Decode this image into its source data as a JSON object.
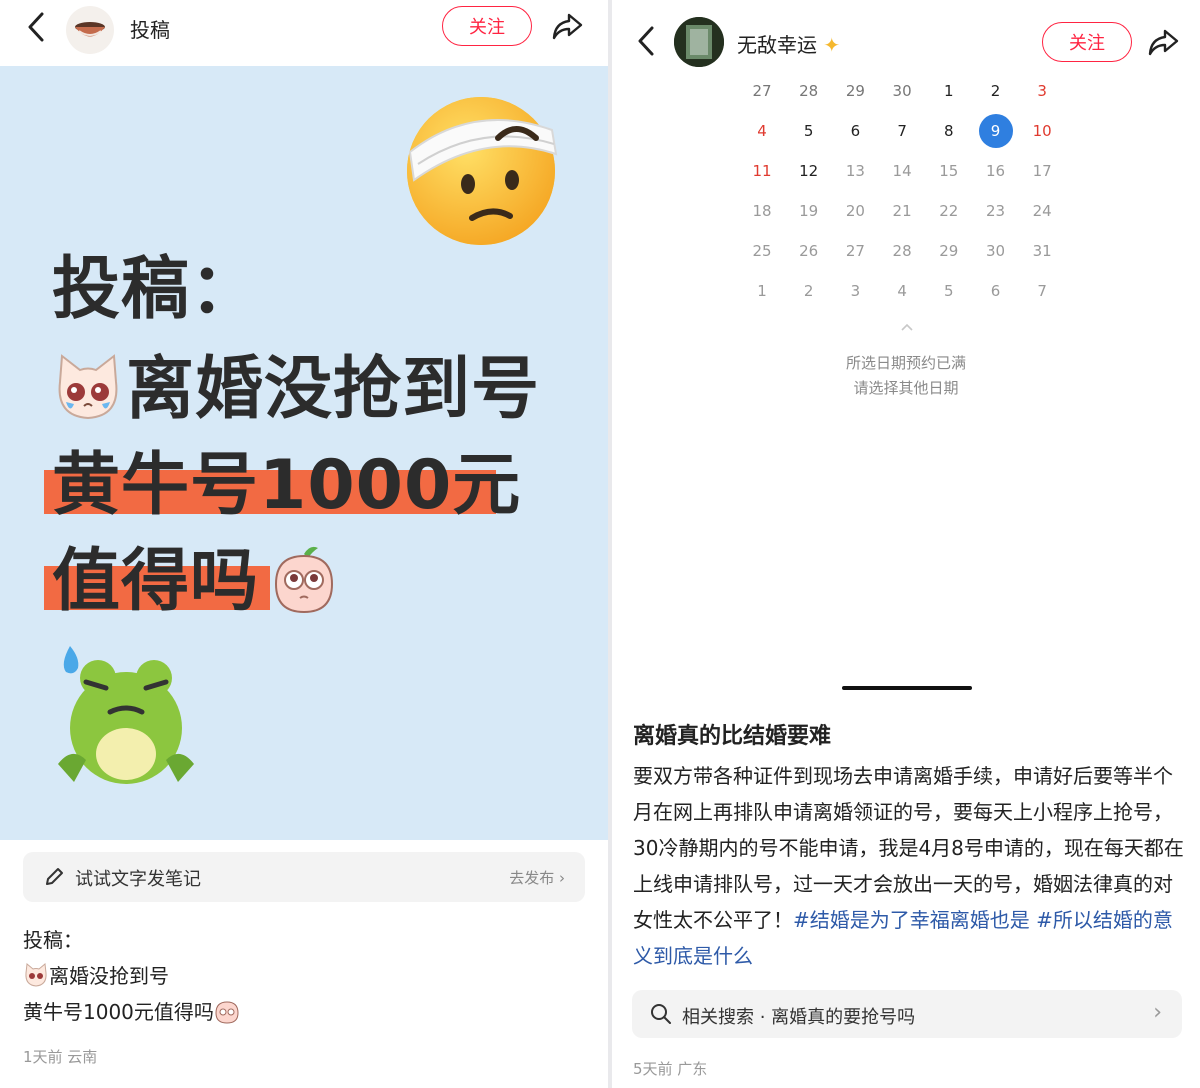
{
  "left_post": {
    "author": "投稿",
    "follow_label": "关注",
    "cover": {
      "line1": "投稿：",
      "line2": "离婚没抢到号",
      "line3": "黄牛号1000元",
      "line4": "值得吗"
    },
    "try_bar": {
      "label": "试试文字发笔记",
      "action": "去发布"
    },
    "description": [
      "投稿：",
      "离婚没抢到号",
      "黄牛号1000元值得吗"
    ],
    "meta": "1天前 云南"
  },
  "right_post": {
    "author": "无敌幸运",
    "follow_label": "关注",
    "calendar": {
      "rows": [
        [
          "27",
          "28",
          "29",
          "30",
          "1",
          "2",
          "3"
        ],
        [
          "4",
          "5",
          "6",
          "7",
          "8",
          "9",
          "10"
        ],
        [
          "11",
          "12",
          "13",
          "14",
          "15",
          "16",
          "17"
        ],
        [
          "18",
          "19",
          "20",
          "21",
          "22",
          "23",
          "24"
        ],
        [
          "25",
          "26",
          "27",
          "28",
          "29",
          "30",
          "31"
        ],
        [
          "1",
          "2",
          "3",
          "4",
          "5",
          "6",
          "7"
        ]
      ],
      "selected": "9"
    },
    "notice_line1": "所选日期预约已满",
    "notice_line2": "请选择其他日期",
    "title": "离婚真的比结婚要难",
    "body": "要双方带各种证件到现场去申请离婚手续，申请好后要等半个月在网上再排队申请离婚领证的号，要每天上小程序上抢号，30冷静期内的号不能申请，我是4月8号申请的，现在每天都在上线申请排队号，过一天才会放出一天的号，婚姻法律真的对女性太不公平了！",
    "tag1": "#结婚是为了幸福离婚也是",
    "tag2": "#所以结婚的意义到底是什么",
    "search_label": "相关搜索 · 离婚真的要抢号吗",
    "meta": "5天前 广东"
  },
  "colors": {
    "accent_red": "#ff2442",
    "cover_bg": "#d7e9f7",
    "highlight": "#f26a43",
    "selected_blue": "#2f7fe0",
    "tag_blue": "#2e5aa8"
  }
}
